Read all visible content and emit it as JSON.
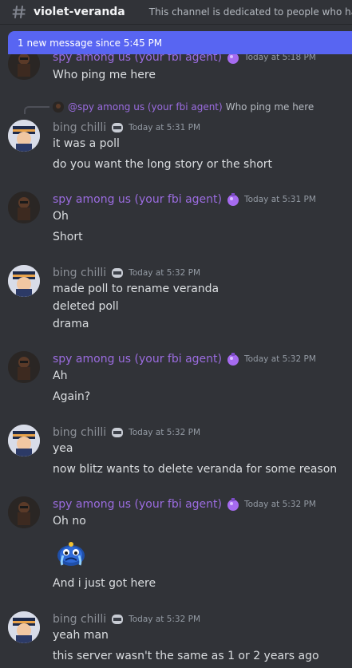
{
  "channel": {
    "name": "violet-veranda",
    "topic": "This channel is dedicated to people who have"
  },
  "banner": {
    "text": "1 new message since 5:45 PM"
  },
  "reply": {
    "name": "@spy among us (your fbi agent)",
    "text": "Who ping me here"
  },
  "users": {
    "spy": "spy among us (your fbi agent)",
    "bing": "bing chilli"
  },
  "messages": [
    {
      "author": "spy among us (your fbi agent)",
      "time": "Today at 5:18 PM",
      "lines": [
        "Who ping me here"
      ]
    },
    {
      "author": "bing chilli",
      "time": "Today at 5:31 PM",
      "lines": [
        "it was a poll",
        "do you want the long story or the short"
      ]
    },
    {
      "author": "spy among us (your fbi agent)",
      "time": "Today at 5:31 PM",
      "lines": [
        "Oh",
        "Short"
      ]
    },
    {
      "author": "bing chilli",
      "time": "Today at 5:32 PM",
      "lines": [
        "made poll to rename veranda",
        "deleted poll",
        "drama"
      ]
    },
    {
      "author": "spy among us (your fbi agent)",
      "time": "Today at 5:32 PM",
      "lines": [
        "Ah",
        "Again?"
      ]
    },
    {
      "author": "bing chilli",
      "time": "Today at 5:32 PM",
      "lines": [
        "yea",
        "now blitz wants to delete veranda for some reason"
      ]
    },
    {
      "author": "spy among us (your fbi agent)",
      "time": "Today at 5:32 PM",
      "lines": [
        "Oh no",
        "And i just got here"
      ]
    },
    {
      "author": "bing chilli",
      "time": "Today at 5:32 PM",
      "lines": [
        "yeah man",
        "this server wasn't the same as 1 or 2 years ago"
      ]
    }
  ],
  "colors": {
    "background": "#313338",
    "banner": "#5865f2",
    "spy_name": "#9b6ce0",
    "bing_name": "#8b8f96",
    "text": "#dbdee1",
    "timestamp": "#949ba4"
  },
  "icons": {
    "channel": "hash-icon",
    "spy_badge": "purple-potion-icon",
    "bing_badge": "helmet-icon",
    "sticker": "crying-blob-sticker"
  }
}
